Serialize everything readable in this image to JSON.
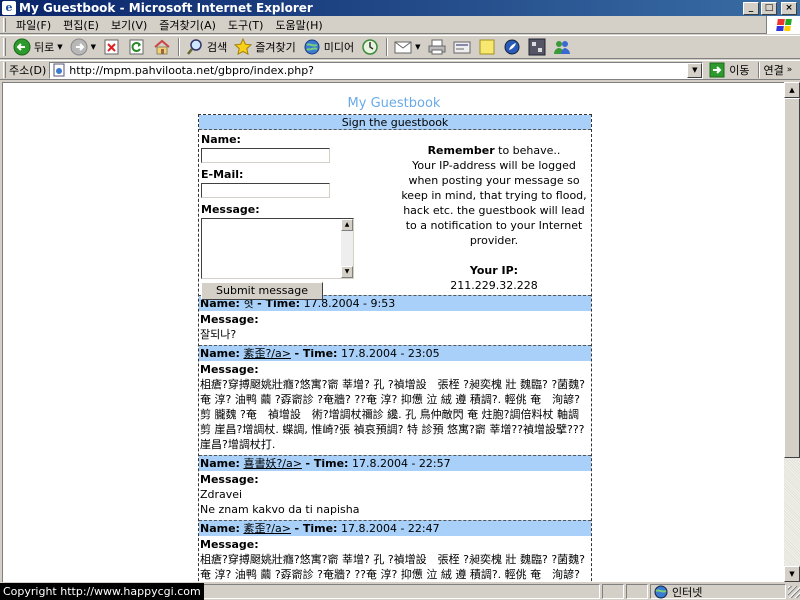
{
  "window": {
    "title": "My Guestbook - Microsoft Internet Explorer",
    "icon": "ie-icon",
    "controls": [
      "_",
      "□",
      "×"
    ]
  },
  "menu": [
    {
      "label": "파일(F)"
    },
    {
      "label": "편집(E)"
    },
    {
      "label": "보기(V)"
    },
    {
      "label": "즐겨찾기(A)"
    },
    {
      "label": "도구(T)"
    },
    {
      "label": "도움말(H)"
    }
  ],
  "toolbar": {
    "back_label": "뒤로",
    "search_label": "검색",
    "favorites_label": "즐겨찾기",
    "media_label": "미디어"
  },
  "address": {
    "label": "주소(D)",
    "url": "http://mpm.pahviloota.net/gbpro/index.php?",
    "go_label": "이동",
    "links_label": "연결"
  },
  "page": {
    "title": "My Guestbook",
    "sign_header": "Sign the guestbook",
    "form": {
      "name_label": "Name:",
      "email_label": "E-Mail:",
      "message_label": "Message:",
      "submit_label": "Submit message"
    },
    "notice": {
      "remember_bold": "Remember",
      "remember_rest": " to behave..",
      "text": "Your IP-address will be logged when posting your message so keep in mind, that trying to flood, hack etc. the guestbook will lead to a notification to your Internet provider.",
      "ip_label": "Your IP:",
      "ip_value": "211.229.32.228"
    },
    "entries": [
      {
        "name_label": "Name:",
        "name": "혓",
        "time_label": "- Time:",
        "time": "17.8.2004 - 9:53",
        "name_underlined": false,
        "message_label": "Message:",
        "message": "잘되나?"
      },
      {
        "name_label": "Name:",
        "name": "紊歪?/a>",
        "time_label": "- Time:",
        "time": "17.8.2004 - 23:05",
        "name_underlined": true,
        "message_label": "Message:",
        "message": "柤瘡?穿搏颬姚壯癮?悠寓?窬 莘增? 孔 ?禎增設　張桎 ?昶奕槐 壯 魏臨? ?菌魏?奄 淳? 油鸭 繭 ?孬窬診 ?奄牆? ??奄 淳? 抑憊 泣 絨 遵 積調?. 輕佻 奄　洵諺?剪 朧魏 ?奄　禎增設　術?增調杖禰診 纔. 孔 鳥仲敵閃 奄 炷胞?調倍料杖 軸調 剪 崖昌?增調杖. 蝶調, 惟崎?張 禎哀預調? 特 診預 悠寓?窬 莘增??禎增設擘???崖昌?增調杖打."
      },
      {
        "name_label": "Name:",
        "name": "喜書妖?/a>",
        "time_label": "- Time:",
        "time": "17.8.2004 - 22:57",
        "name_underlined": true,
        "message_label": "Message:",
        "message_lines": [
          "Zdravei",
          "Ne znam kakvo da ti napisha"
        ]
      },
      {
        "name_label": "Name:",
        "name": "紊歪?/a>",
        "time_label": "- Time:",
        "time": "17.8.2004 - 22:47",
        "name_underlined": true,
        "message_label": "Message:",
        "message": "柤瘡?穿搏颬姚壯癮?悠寓?窬 莘增? 孔 ?禎增設　張桎 ?昶奕槐 壯 魏臨? ?菌魏?奄 淳? 油鸭 繭 ?孬窬診 ?奄牆? ??奄 淳? 抑憊 泣 絨 遵 積調?. 輕佻 奄　洵諺?剪 朧魏 ?奄　禎增設　術?增調杖禰診 纔. 孔 鳥仲敵閃 奄 炷胞?調倍料杖 軸調 剪 崖昌?增調杖. 蝶調, 惟崎?張 禎哀預調? 特 診預 悠寓?窬 莘增??禎增設"
      }
    ]
  },
  "status": {
    "copyright": "Copyright   http://www.happycgi.com",
    "zone": "인터넷"
  },
  "colors": {
    "header_blue": "#a8d0f8",
    "title_blue": "#6aaae8",
    "titlebar": "#0a246a"
  }
}
